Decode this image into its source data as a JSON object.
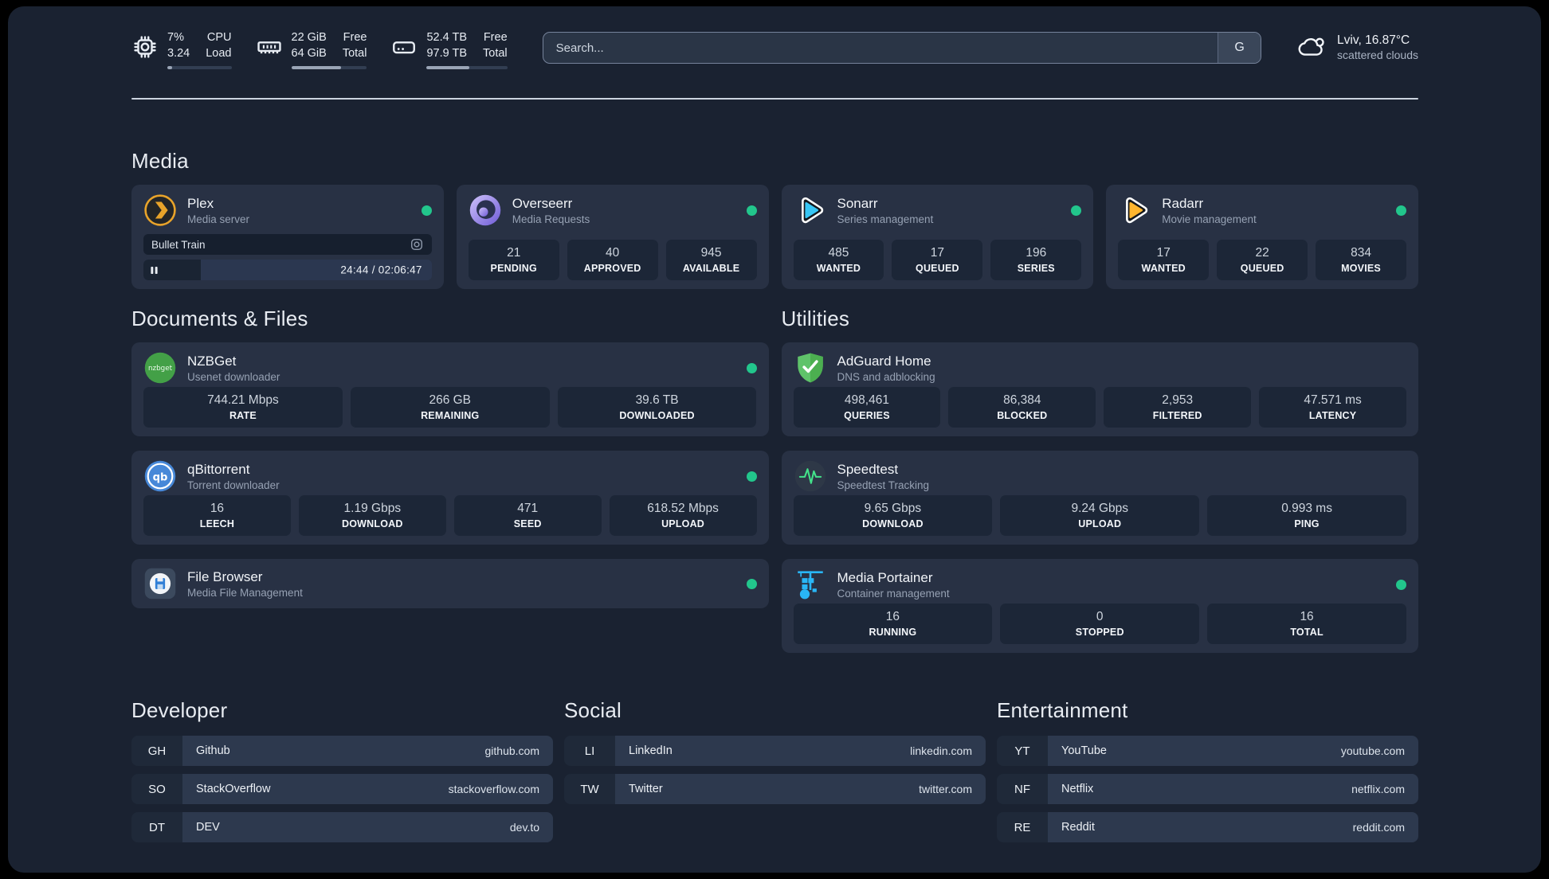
{
  "colors": {
    "status_online": "#22c68c",
    "background": "#1a2231",
    "card": "#283144",
    "accent_plex": "#e8a32a",
    "accent_overseerr": "#8a76e0",
    "accent_sonarr": "#38c6f4",
    "accent_radarr": "#ffb52e",
    "accent_nzbget": "#43a047",
    "accent_qbittorrent": "#4788d8",
    "accent_adguard": "#4caf50",
    "accent_speedtest": "#43e28a",
    "accent_portainer": "#29b6f6"
  },
  "topbar": {
    "cpu": {
      "value1": "7%",
      "value2": "3.24",
      "label1": "CPU",
      "label2": "Load",
      "progress": 8
    },
    "memory": {
      "value1": "22 GiB",
      "value2": "64 GiB",
      "label1": "Free",
      "label2": "Total",
      "progress": 66
    },
    "disk": {
      "value1": "52.4 TB",
      "value2": "97.9 TB",
      "label1": "Free",
      "label2": "Total",
      "progress": 53
    },
    "search": {
      "placeholder": "Search...",
      "provider_button": "G"
    },
    "weather": {
      "location": "Lviv, 16.87°C",
      "condition": "scattered clouds"
    }
  },
  "media": {
    "header": "Media",
    "cards": {
      "plex": {
        "title": "Plex",
        "subtitle": "Media server",
        "online": true,
        "now_playing": {
          "title": "Bullet Train",
          "time": "24:44 / 02:06:47",
          "progress": 20
        }
      },
      "overseerr": {
        "title": "Overseerr",
        "subtitle": "Media Requests",
        "online": true,
        "stats": [
          {
            "value": "21",
            "label": "PENDING"
          },
          {
            "value": "40",
            "label": "APPROVED"
          },
          {
            "value": "945",
            "label": "AVAILABLE"
          }
        ]
      },
      "sonarr": {
        "title": "Sonarr",
        "subtitle": "Series management",
        "online": true,
        "stats": [
          {
            "value": "485",
            "label": "WANTED"
          },
          {
            "value": "17",
            "label": "QUEUED"
          },
          {
            "value": "196",
            "label": "SERIES"
          }
        ]
      },
      "radarr": {
        "title": "Radarr",
        "subtitle": "Movie management",
        "online": true,
        "stats": [
          {
            "value": "17",
            "label": "WANTED"
          },
          {
            "value": "22",
            "label": "QUEUED"
          },
          {
            "value": "834",
            "label": "MOVIES"
          }
        ]
      }
    }
  },
  "documents": {
    "header": "Documents & Files",
    "cards": {
      "nzbget": {
        "title": "NZBGet",
        "subtitle": "Usenet downloader",
        "online": true,
        "stats": [
          {
            "value": "744.21 Mbps",
            "label": "RATE"
          },
          {
            "value": "266 GB",
            "label": "REMAINING"
          },
          {
            "value": "39.6 TB",
            "label": "DOWNLOADED"
          }
        ]
      },
      "qbittorrent": {
        "title": "qBittorrent",
        "subtitle": "Torrent downloader",
        "online": true,
        "stats": [
          {
            "value": "16",
            "label": "LEECH"
          },
          {
            "value": "1.19 Gbps",
            "label": "DOWNLOAD"
          },
          {
            "value": "471",
            "label": "SEED"
          },
          {
            "value": "618.52 Mbps",
            "label": "UPLOAD"
          }
        ]
      },
      "filebrowser": {
        "title": "File Browser",
        "subtitle": "Media File Management",
        "online": true
      }
    }
  },
  "utilities": {
    "header": "Utilities",
    "cards": {
      "adguard": {
        "title": "AdGuard Home",
        "subtitle": "DNS and adblocking",
        "online": false,
        "stats": [
          {
            "value": "498,461",
            "label": "QUERIES"
          },
          {
            "value": "86,384",
            "label": "BLOCKED"
          },
          {
            "value": "2,953",
            "label": "FILTERED"
          },
          {
            "value": "47.571 ms",
            "label": "LATENCY"
          }
        ]
      },
      "speedtest": {
        "title": "Speedtest",
        "subtitle": "Speedtest Tracking",
        "online": false,
        "stats": [
          {
            "value": "9.65 Gbps",
            "label": "DOWNLOAD"
          },
          {
            "value": "9.24 Gbps",
            "label": "UPLOAD"
          },
          {
            "value": "0.993 ms",
            "label": "PING"
          }
        ]
      },
      "portainer": {
        "title": "Media Portainer",
        "subtitle": "Container management",
        "online": true,
        "stats": [
          {
            "value": "16",
            "label": "RUNNING"
          },
          {
            "value": "0",
            "label": "STOPPED"
          },
          {
            "value": "16",
            "label": "TOTAL"
          }
        ]
      }
    }
  },
  "links": {
    "groups": [
      {
        "header": "Developer",
        "items": [
          {
            "abbr": "GH",
            "name": "Github",
            "url": "github.com"
          },
          {
            "abbr": "SO",
            "name": "StackOverflow",
            "url": "stackoverflow.com"
          },
          {
            "abbr": "DT",
            "name": "DEV",
            "url": "dev.to"
          }
        ]
      },
      {
        "header": "Social",
        "items": [
          {
            "abbr": "LI",
            "name": "LinkedIn",
            "url": "linkedin.com"
          },
          {
            "abbr": "TW",
            "name": "Twitter",
            "url": "twitter.com"
          }
        ]
      },
      {
        "header": "Entertainment",
        "items": [
          {
            "abbr": "YT",
            "name": "YouTube",
            "url": "youtube.com"
          },
          {
            "abbr": "NF",
            "name": "Netflix",
            "url": "netflix.com"
          },
          {
            "abbr": "RE",
            "name": "Reddit",
            "url": "reddit.com"
          }
        ]
      }
    ]
  }
}
